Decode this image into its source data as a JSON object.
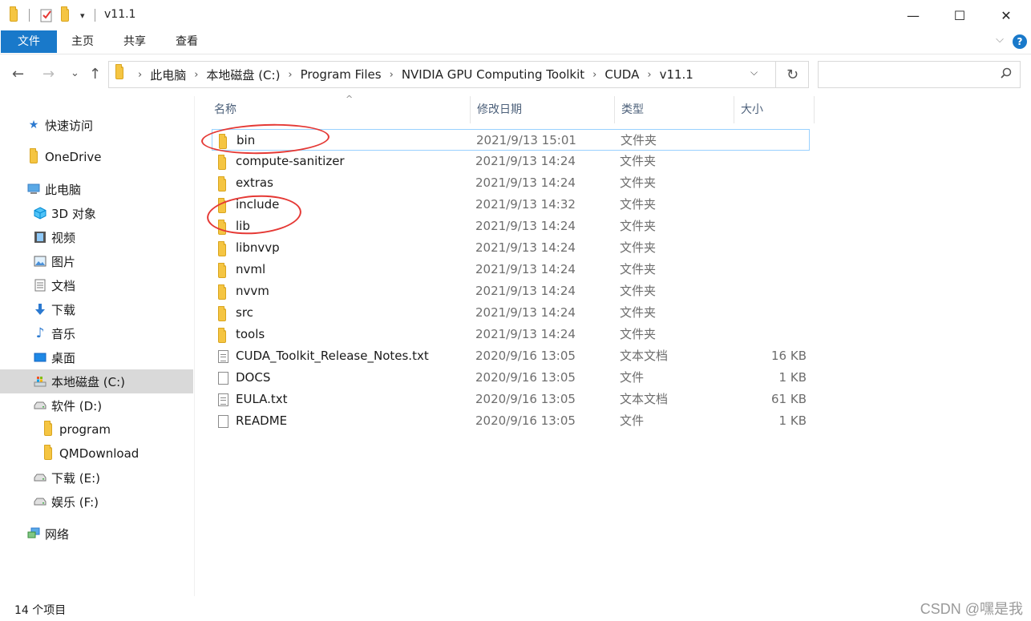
{
  "window": {
    "title": "v11.1",
    "minimize_glyph": "—",
    "maximize_glyph": "☐",
    "close_glyph": "✕"
  },
  "ribbon": {
    "tabs": [
      "文件",
      "主页",
      "共享",
      "查看"
    ],
    "help_glyph": "?",
    "collapse_glyph": "⌵"
  },
  "nav": {
    "back_glyph": "←",
    "forward_glyph": "→",
    "recent_glyph": "⌄",
    "up_glyph": "↑",
    "breadcrumb": [
      "此电脑",
      "本地磁盘 (C:)",
      "Program Files",
      "NVIDIA GPU Computing Toolkit",
      "CUDA",
      "v11.1"
    ],
    "refresh_glyph": "↻",
    "dropdown_glyph": "⌵",
    "search_placeholder": "",
    "search_glyph": "🔍"
  },
  "sidebar": {
    "items": [
      {
        "label": "快速访问",
        "icon": "star-icon"
      },
      {
        "label": "OneDrive",
        "icon": "folder-icon"
      },
      {
        "label": "此电脑",
        "icon": "computer-icon"
      },
      {
        "label": "3D 对象",
        "icon": "cube-icon"
      },
      {
        "label": "视频",
        "icon": "video-icon"
      },
      {
        "label": "图片",
        "icon": "picture-icon"
      },
      {
        "label": "文档",
        "icon": "document-icon"
      },
      {
        "label": "下载",
        "icon": "download-icon"
      },
      {
        "label": "音乐",
        "icon": "music-icon"
      },
      {
        "label": "桌面",
        "icon": "desktop-icon"
      },
      {
        "label": "本地磁盘 (C:)",
        "icon": "drive-c-icon"
      },
      {
        "label": "软件 (D:)",
        "icon": "drive-icon"
      },
      {
        "label": "program",
        "icon": "folder-icon"
      },
      {
        "label": "QMDownload",
        "icon": "folder-icon"
      },
      {
        "label": "下载 (E:)",
        "icon": "drive-icon"
      },
      {
        "label": "娱乐 (F:)",
        "icon": "drive-icon"
      },
      {
        "label": "网络",
        "icon": "network-icon"
      }
    ],
    "selected_index": 10
  },
  "columns": {
    "name": "名称",
    "date": "修改日期",
    "type": "类型",
    "size": "大小",
    "sort_glyph": "^"
  },
  "files": [
    {
      "name": "bin",
      "date": "2021/9/13 15:01",
      "type": "文件夹",
      "size": "",
      "kind": "folder"
    },
    {
      "name": "compute-sanitizer",
      "date": "2021/9/13 14:24",
      "type": "文件夹",
      "size": "",
      "kind": "folder"
    },
    {
      "name": "extras",
      "date": "2021/9/13 14:24",
      "type": "文件夹",
      "size": "",
      "kind": "folder"
    },
    {
      "name": "include",
      "date": "2021/9/13 14:32",
      "type": "文件夹",
      "size": "",
      "kind": "folder"
    },
    {
      "name": "lib",
      "date": "2021/9/13 14:24",
      "type": "文件夹",
      "size": "",
      "kind": "folder"
    },
    {
      "name": "libnvvp",
      "date": "2021/9/13 14:24",
      "type": "文件夹",
      "size": "",
      "kind": "folder"
    },
    {
      "name": "nvml",
      "date": "2021/9/13 14:24",
      "type": "文件夹",
      "size": "",
      "kind": "folder"
    },
    {
      "name": "nvvm",
      "date": "2021/9/13 14:24",
      "type": "文件夹",
      "size": "",
      "kind": "folder"
    },
    {
      "name": "src",
      "date": "2021/9/13 14:24",
      "type": "文件夹",
      "size": "",
      "kind": "folder"
    },
    {
      "name": "tools",
      "date": "2021/9/13 14:24",
      "type": "文件夹",
      "size": "",
      "kind": "folder"
    },
    {
      "name": "CUDA_Toolkit_Release_Notes.txt",
      "date": "2020/9/16 13:05",
      "type": "文本文档",
      "size": "16 KB",
      "kind": "text"
    },
    {
      "name": "DOCS",
      "date": "2020/9/16 13:05",
      "type": "文件",
      "size": "1 KB",
      "kind": "file"
    },
    {
      "name": "EULA.txt",
      "date": "2020/9/16 13:05",
      "type": "文本文档",
      "size": "61 KB",
      "kind": "text"
    },
    {
      "name": "README",
      "date": "2020/9/16 13:05",
      "type": "文件",
      "size": "1 KB",
      "kind": "file"
    }
  ],
  "status": {
    "item_count": "14 个项目",
    "watermark": "CSDN @嘿是我"
  }
}
